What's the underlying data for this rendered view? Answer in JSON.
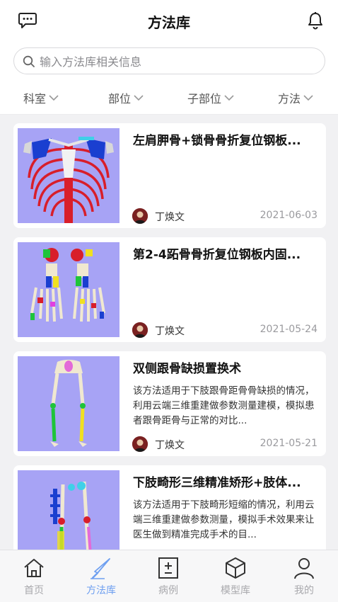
{
  "header": {
    "title": "方法库",
    "left_icon": "chat-icon",
    "right_icon": "bell-icon"
  },
  "search": {
    "placeholder": "输入方法库相关信息",
    "value": ""
  },
  "filters": [
    {
      "label": "科室"
    },
    {
      "label": "部位"
    },
    {
      "label": "子部位"
    },
    {
      "label": "方法"
    }
  ],
  "cards": [
    {
      "title": "左肩胛骨+锁骨骨折复位钢板...",
      "description": "",
      "author": "丁焕文",
      "date": "2021-06-03"
    },
    {
      "title": "第2-4跖骨骨折复位钢板内固...",
      "description": "",
      "author": "丁焕文",
      "date": "2021-05-24"
    },
    {
      "title": "双侧跟骨缺损置换术",
      "description": "该方法适用于下肢跟骨距骨骨缺损的情况，利用云端三维重建做参数测量建模，模拟患者跟骨距骨与正常的对比...",
      "author": "丁焕文",
      "date": "2021-05-21"
    },
    {
      "title": "下肢畸形三维精准矫形+肢体...",
      "description": "该方法适用于下肢畸形短缩的情况，利用云端三维重建做参数测量，模拟手术效果来让医生做到精准完成手术的目...",
      "author": "",
      "date": ""
    }
  ],
  "tabbar": [
    {
      "label": "首页",
      "icon": "home-icon",
      "active": false
    },
    {
      "label": "方法库",
      "icon": "scalpel-icon",
      "active": true
    },
    {
      "label": "病例",
      "icon": "case-icon",
      "active": false
    },
    {
      "label": "模型库",
      "icon": "cube-icon",
      "active": false
    },
    {
      "label": "我的",
      "icon": "user-icon",
      "active": false
    }
  ],
  "colors": {
    "accent": "#6e9ff0",
    "inactive": "#a9a9ad",
    "thumb_bg": "#a7a3f5"
  }
}
